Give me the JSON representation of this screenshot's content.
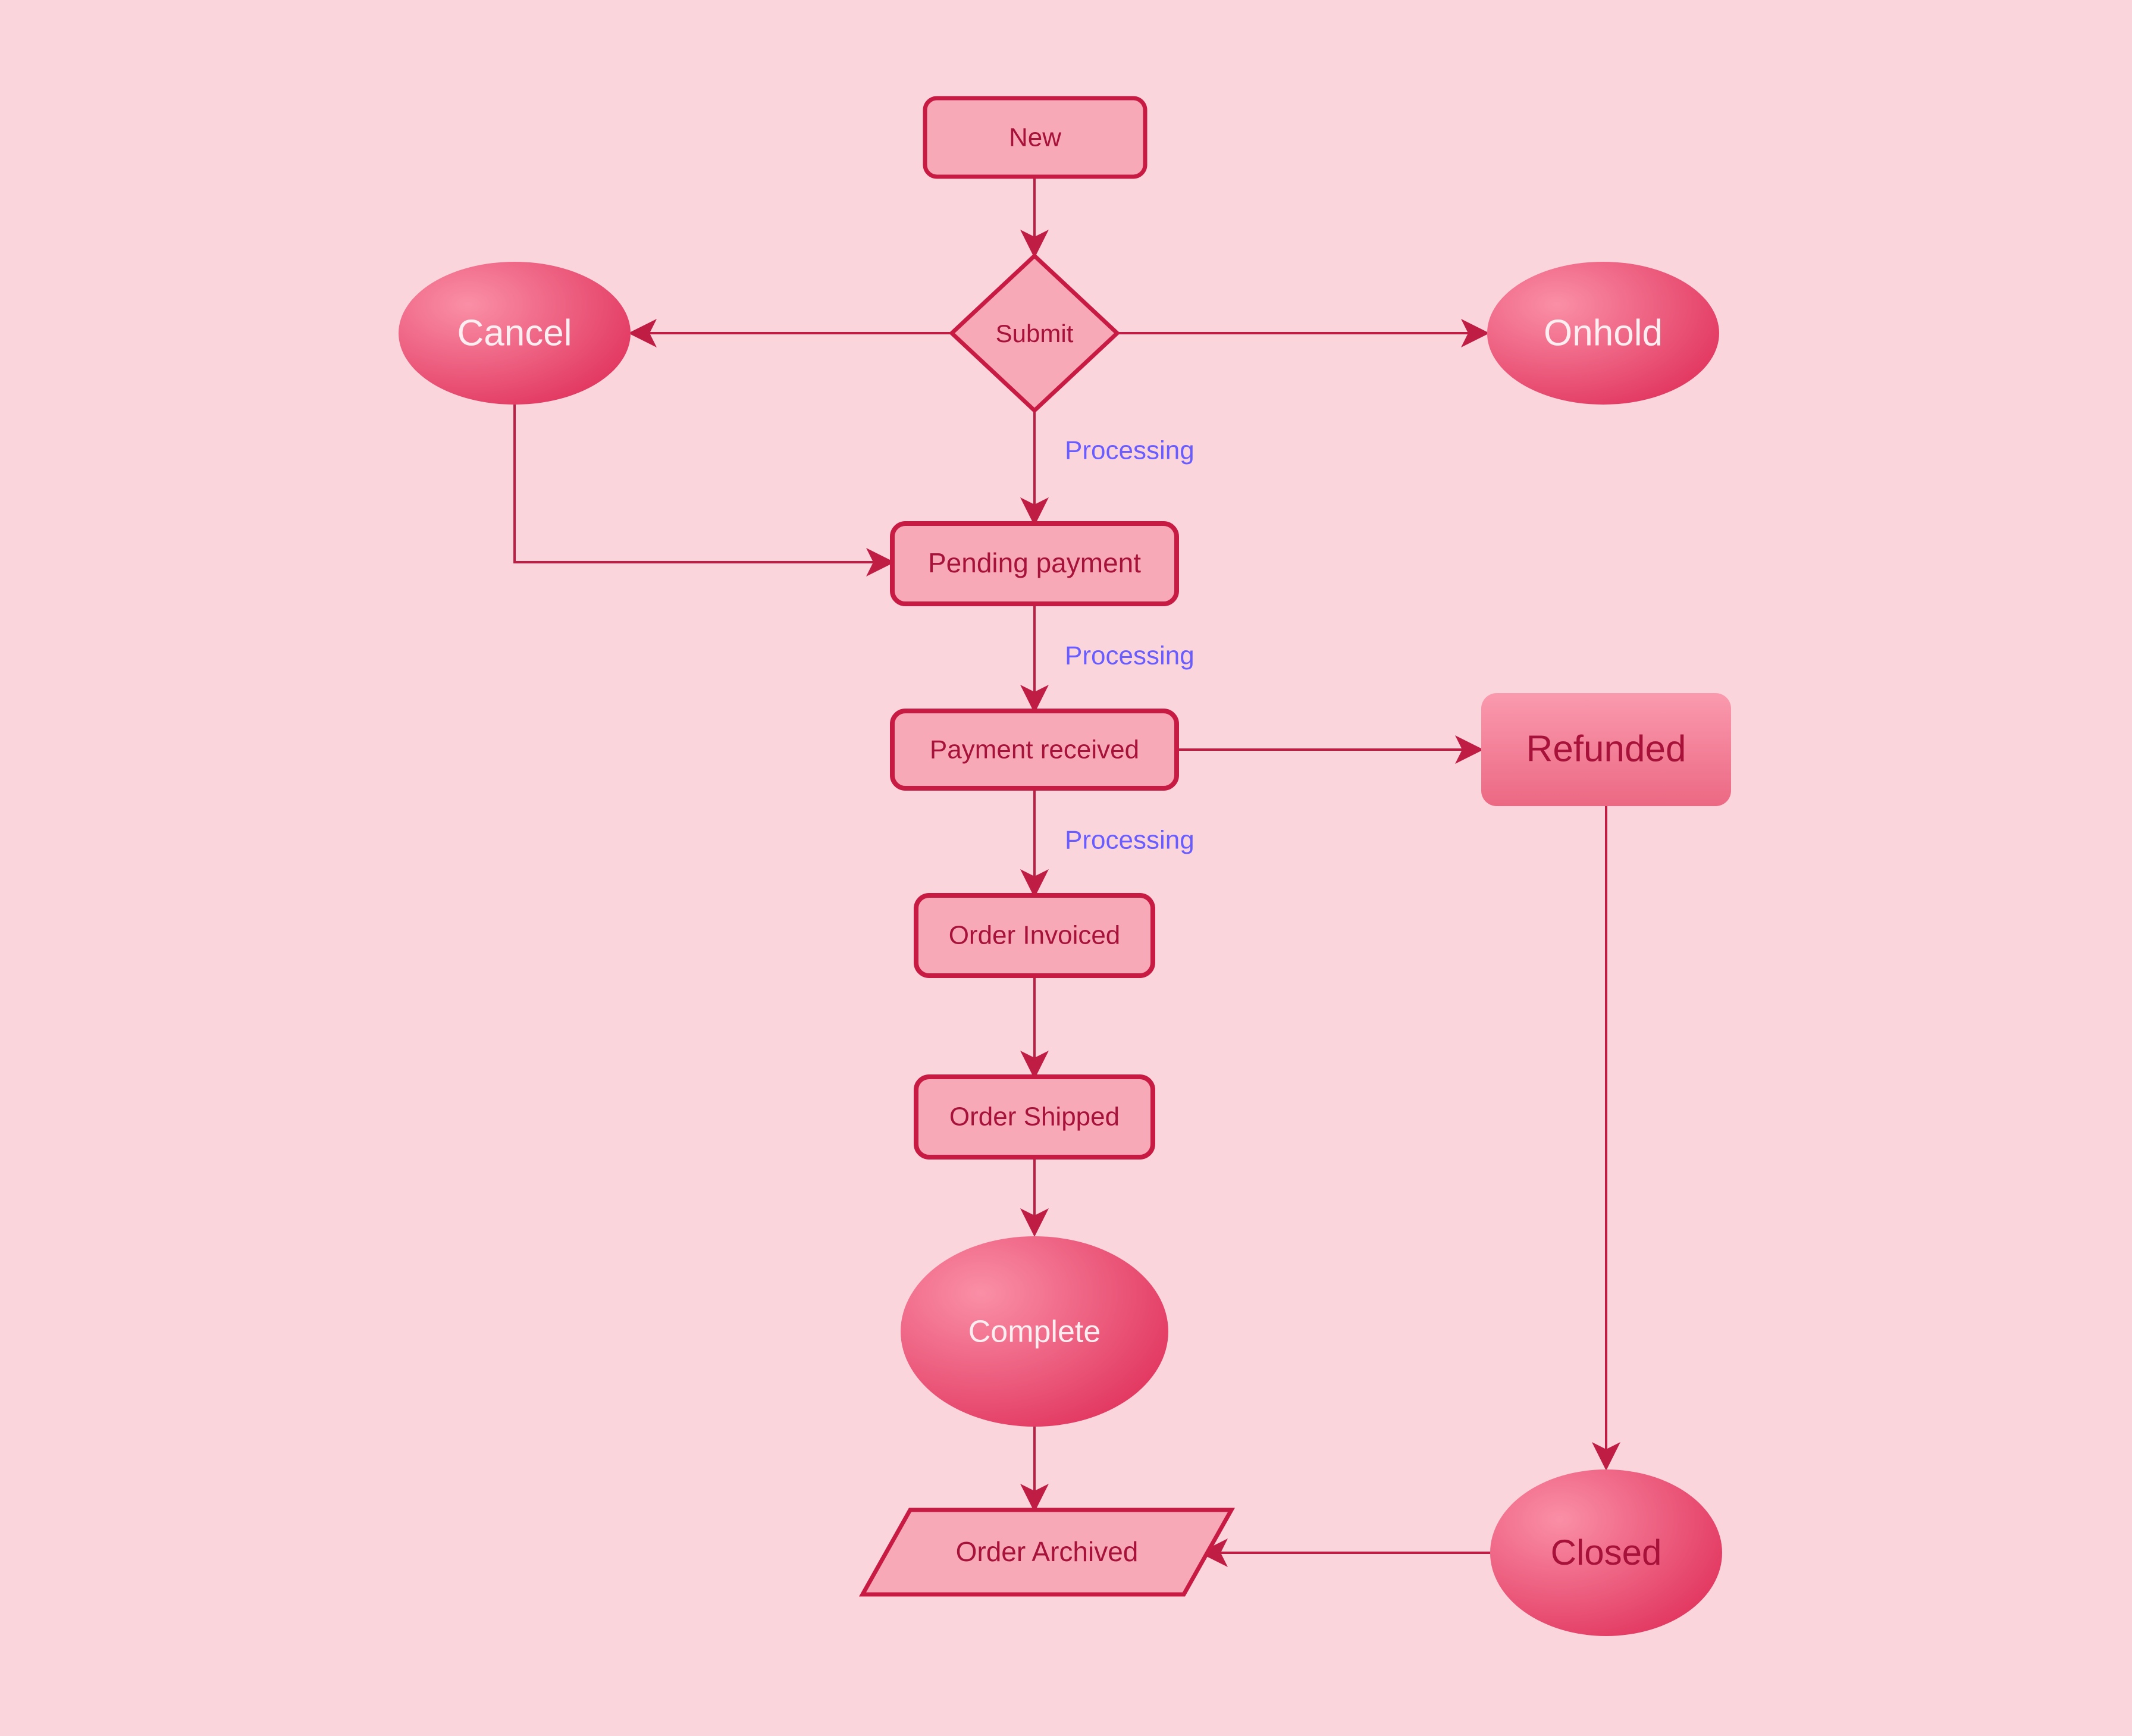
{
  "chart_data": {
    "type": "flowchart",
    "nodes": [
      {
        "id": "new",
        "label": "New",
        "shape": "rect"
      },
      {
        "id": "submit",
        "label": "Submit",
        "shape": "diamond"
      },
      {
        "id": "cancel",
        "label": "Cancel",
        "shape": "ellipse"
      },
      {
        "id": "onhold",
        "label": "Onhold",
        "shape": "ellipse"
      },
      {
        "id": "pending",
        "label": "Pending payment",
        "shape": "rect"
      },
      {
        "id": "received",
        "label": "Payment received",
        "shape": "rect"
      },
      {
        "id": "refunded",
        "label": "Refunded",
        "shape": "rect"
      },
      {
        "id": "invoiced",
        "label": "Order Invoiced",
        "shape": "rect"
      },
      {
        "id": "shipped",
        "label": "Order Shipped",
        "shape": "rect"
      },
      {
        "id": "complete",
        "label": "Complete",
        "shape": "ellipse"
      },
      {
        "id": "archived",
        "label": "Order Archived",
        "shape": "parallelogram"
      },
      {
        "id": "closed",
        "label": "Closed",
        "shape": "ellipse"
      }
    ],
    "edges": [
      {
        "from": "new",
        "to": "submit"
      },
      {
        "from": "submit",
        "to": "cancel"
      },
      {
        "from": "submit",
        "to": "onhold"
      },
      {
        "from": "submit",
        "to": "pending",
        "label": "Processing"
      },
      {
        "from": "cancel",
        "to": "pending"
      },
      {
        "from": "pending",
        "to": "received",
        "label": "Processing"
      },
      {
        "from": "received",
        "to": "refunded"
      },
      {
        "from": "received",
        "to": "invoiced",
        "label": "Processing"
      },
      {
        "from": "invoiced",
        "to": "shipped"
      },
      {
        "from": "shipped",
        "to": "complete"
      },
      {
        "from": "complete",
        "to": "archived"
      },
      {
        "from": "refunded",
        "to": "closed"
      },
      {
        "from": "closed",
        "to": "archived"
      }
    ]
  },
  "labels": {
    "new": "New",
    "submit": "Submit",
    "cancel": "Cancel",
    "onhold": "Onhold",
    "pending": "Pending payment",
    "received": "Payment received",
    "refunded": "Refunded",
    "invoiced": "Order Invoiced",
    "shipped": "Order Shipped",
    "complete": "Complete",
    "archived": "Order Archived",
    "closed": "Closed",
    "processing": "Processing"
  }
}
